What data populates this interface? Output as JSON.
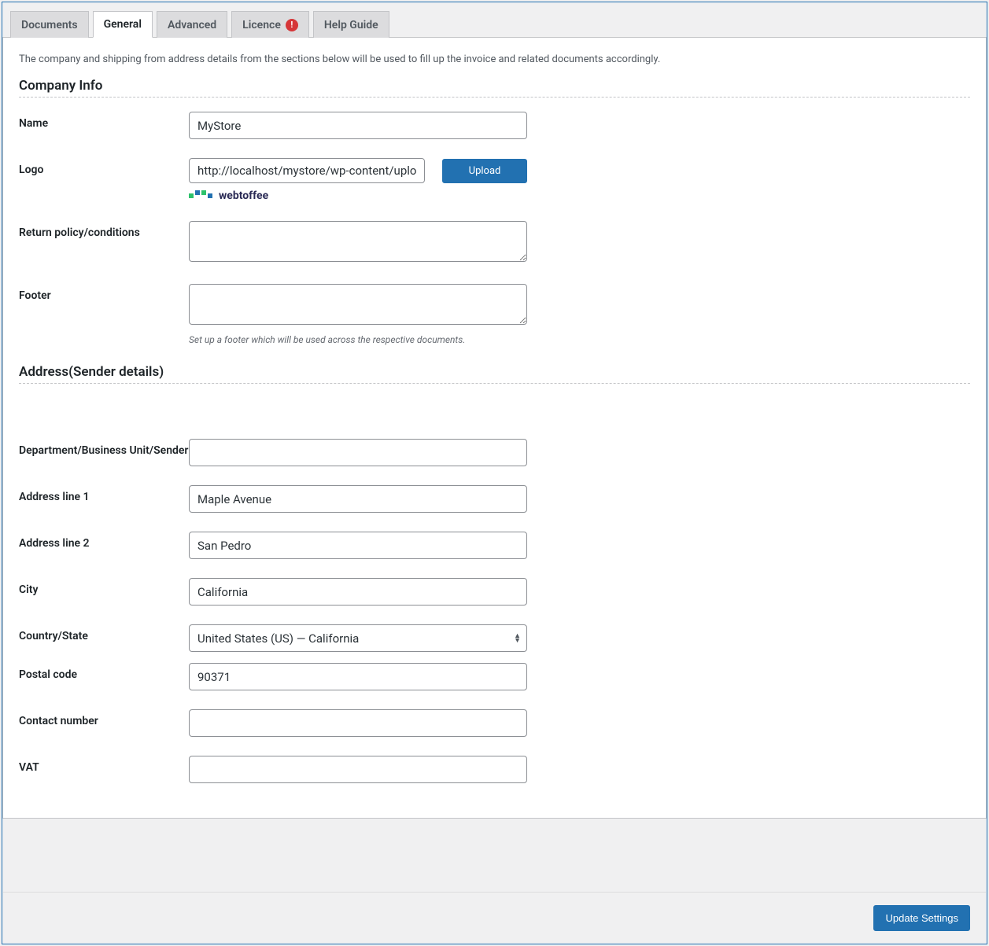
{
  "tabs": {
    "documents": "Documents",
    "general": "General",
    "advanced": "Advanced",
    "licence": "Licence",
    "licence_badge": "!",
    "help": "Help Guide"
  },
  "intro": "The company and shipping from address details from the sections below will be used to fill up the invoice and related documents accordingly.",
  "sections": {
    "company": "Company Info",
    "address": "Address(Sender details)"
  },
  "labels": {
    "name": "Name",
    "logo": "Logo",
    "return_policy": "Return policy/conditions",
    "footer": "Footer",
    "department": "Department/Business Unit/Sender",
    "addr1": "Address line 1",
    "addr2": "Address line 2",
    "city": "City",
    "country": "Country/State",
    "postal": "Postal code",
    "contact": "Contact number",
    "vat": "VAT"
  },
  "values": {
    "name": "MyStore",
    "logo": "http://localhost/mystore/wp-content/uploac",
    "return_policy": "",
    "footer": "",
    "department": "",
    "addr1": "Maple Avenue",
    "addr2": "San Pedro",
    "city": "California",
    "country": "United States (US) — California",
    "postal": "90371",
    "contact": "",
    "vat": ""
  },
  "footer_help": "Set up a footer which will be used across the respective documents.",
  "buttons": {
    "upload": "Upload",
    "update": "Update Settings"
  },
  "logo_preview_text": "webtoffee"
}
